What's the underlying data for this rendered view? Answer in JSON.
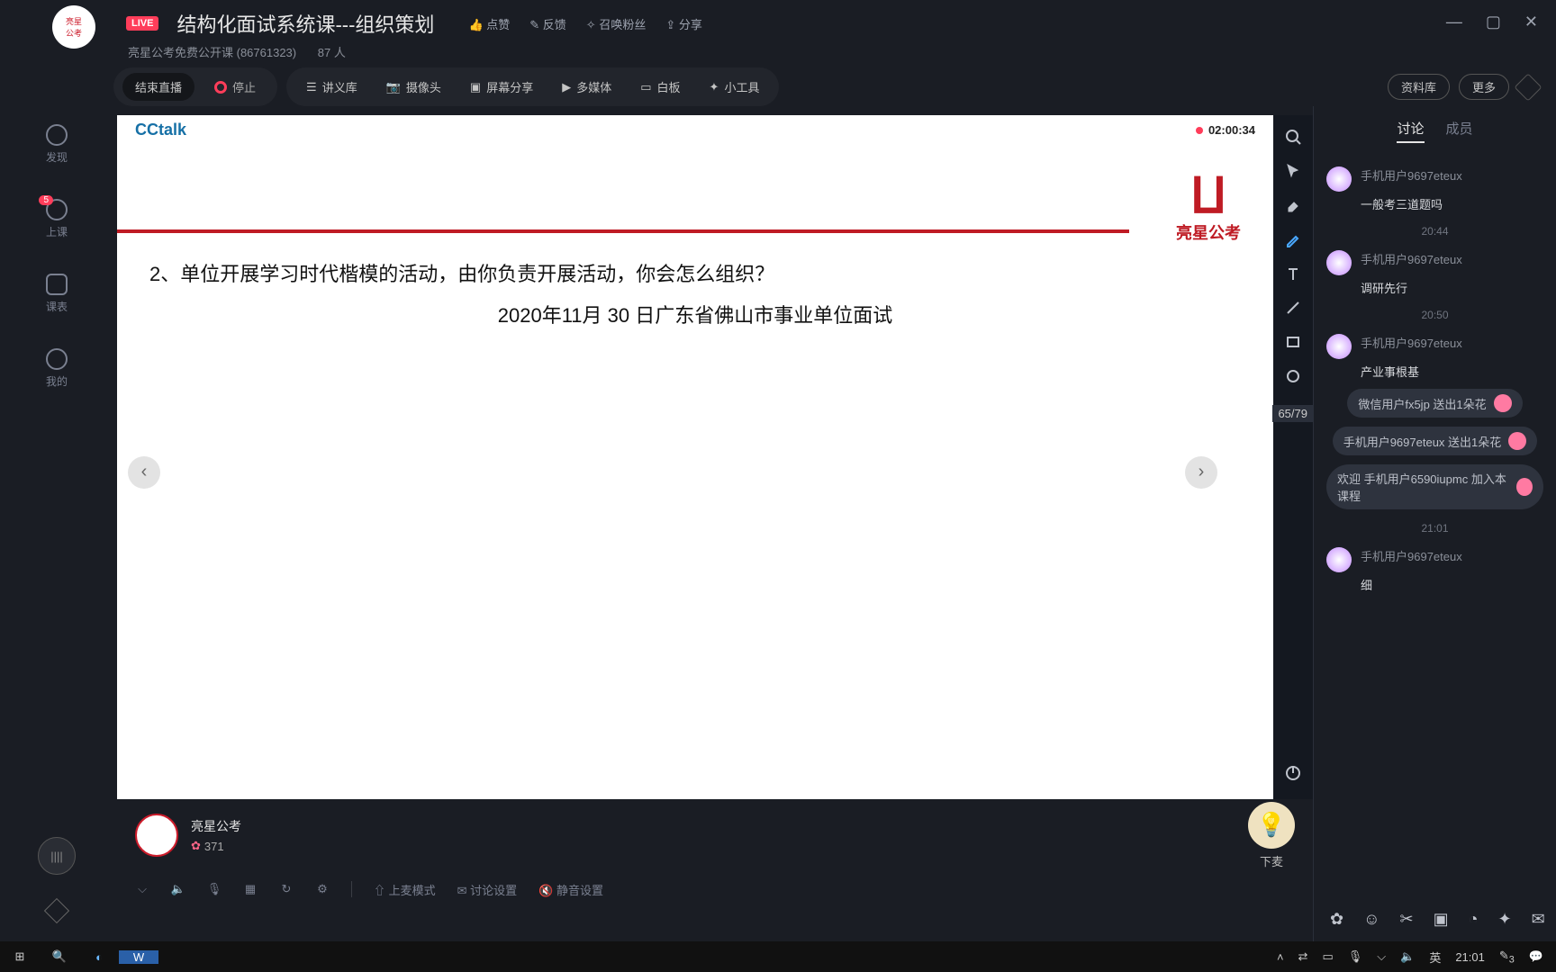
{
  "window": {
    "live_badge": "LIVE",
    "title": "结构化面试系统课---组织策划",
    "actions": {
      "like": "点赞",
      "feedback": "反馈",
      "invite": "召唤粉丝",
      "share": "分享"
    },
    "subtitle_course": "亮星公考免费公开课 (86761323)",
    "subtitle_viewers": "87 人"
  },
  "toolbar": {
    "end_live": "结束直播",
    "stop": "停止",
    "lecture_lib": "讲义库",
    "camera": "摄像头",
    "screen_share": "屏幕分享",
    "multimedia": "多媒体",
    "whiteboard": "白板",
    "gadgets": "小工具",
    "resource_lib": "资料库",
    "more": "更多"
  },
  "leftrail": {
    "items": [
      {
        "label": "发现"
      },
      {
        "label": "上课",
        "badge": "5"
      },
      {
        "label": "课表"
      },
      {
        "label": "我的"
      }
    ]
  },
  "slide": {
    "brand": "CCtalk",
    "timer": "02:00:34",
    "logo_text": "亮星公考",
    "question": "2、单位开展学习时代楷模的活动，由你负责开展活动，你会怎么组织？",
    "subline": "2020年11月 30 日广东省佛山市事业单位面试",
    "page_counter": "65/79"
  },
  "speaker": {
    "name": "亮星公考",
    "flower_count": "371",
    "mic_label": "下麦"
  },
  "bottom_tools": {
    "mic_mode": "上麦模式",
    "discuss_settings": "讨论设置",
    "mute_settings": "静音设置"
  },
  "chat": {
    "tabs": {
      "discuss": "讨论",
      "members": "成员"
    },
    "items": [
      {
        "type": "msg",
        "user": "手机用户9697eteux",
        "text": "一般考三道题吗"
      },
      {
        "type": "time",
        "text": "20:44"
      },
      {
        "type": "msg",
        "user": "手机用户9697eteux",
        "text": "调研先行"
      },
      {
        "type": "time",
        "text": "20:50"
      },
      {
        "type": "msg",
        "user": "手机用户9697eteux",
        "text": "产业事根基"
      },
      {
        "type": "gift",
        "text": "微信用户fx5jp 送出1朵花"
      },
      {
        "type": "gift",
        "text": "手机用户9697eteux 送出1朵花"
      },
      {
        "type": "gift",
        "text": "欢迎 手机用户6590iupmc 加入本课程"
      },
      {
        "type": "time",
        "text": "21:01"
      },
      {
        "type": "msg",
        "user": "手机用户9697eteux",
        "text": "细"
      }
    ]
  },
  "taskbar": {
    "ime": "英",
    "clock": "21:01",
    "badge": "3"
  }
}
